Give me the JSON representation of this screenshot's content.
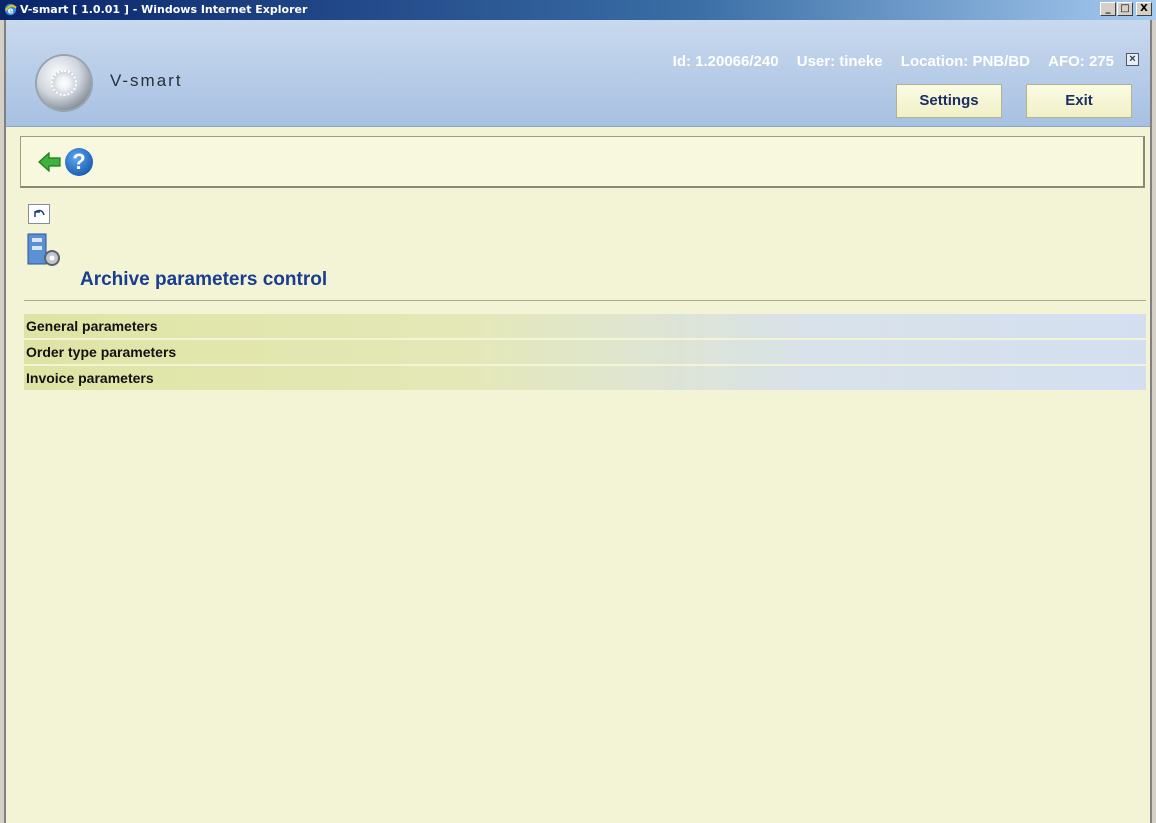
{
  "window": {
    "title": "V-smart [ 1.0.01 ] - Windows Internet Explorer",
    "min_label": "_",
    "max_label": "□",
    "close_label": "X"
  },
  "header": {
    "logo_text": "V-smart",
    "id_text": "Id: 1.20066/240",
    "user_text": "User: tineke",
    "location_text": "Location: PNB/BD",
    "afo_text": "AFO: 275",
    "close_label": "×",
    "settings_label": "Settings",
    "exit_label": "Exit"
  },
  "toolbar": {
    "back_icon": "green-left-arrow",
    "help_icon": "question-mark",
    "help_label": "?"
  },
  "page": {
    "title": "Archive parameters control",
    "icon": "archive-settings-icon"
  },
  "parameters": [
    {
      "label": "General parameters"
    },
    {
      "label": "Order type parameters"
    },
    {
      "label": "Invoice parameters"
    }
  ],
  "colors": {
    "background": "#f3f4d5",
    "title_blue": "#1a3d8f",
    "header_blue": "#a7c1e2"
  }
}
